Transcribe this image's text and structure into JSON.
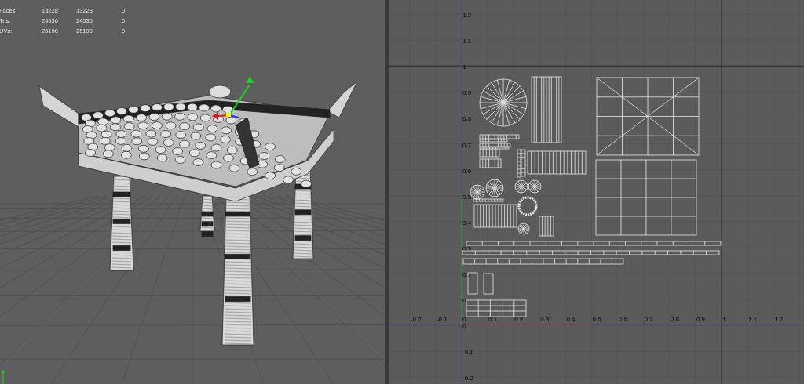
{
  "viewport": {
    "stats": [
      {
        "label": "Faces:",
        "values": [
          "13228",
          "13228",
          "0"
        ]
      },
      {
        "label": "Tris:",
        "values": [
          "24536",
          "24536",
          "0"
        ]
      },
      {
        "label": "UVs:",
        "values": [
          "25190",
          "25190",
          "0"
        ]
      }
    ]
  },
  "uv_editor": {
    "u_labels": [
      "-0.2",
      "-0.1",
      "0",
      "0.1",
      "0.2",
      "0.3",
      "0.4",
      "0.5",
      "0.6",
      "0.7",
      "0.8",
      "0.9",
      "1",
      "1.1",
      "1.2"
    ],
    "v_labels": [
      "1.2",
      "1.1",
      "1",
      "0.9",
      "0.8",
      "0.7",
      "0.6",
      "0.5",
      "0.4",
      "0.3",
      "0.2",
      "0.1",
      "0",
      "-0.1",
      "-0.2"
    ]
  }
}
